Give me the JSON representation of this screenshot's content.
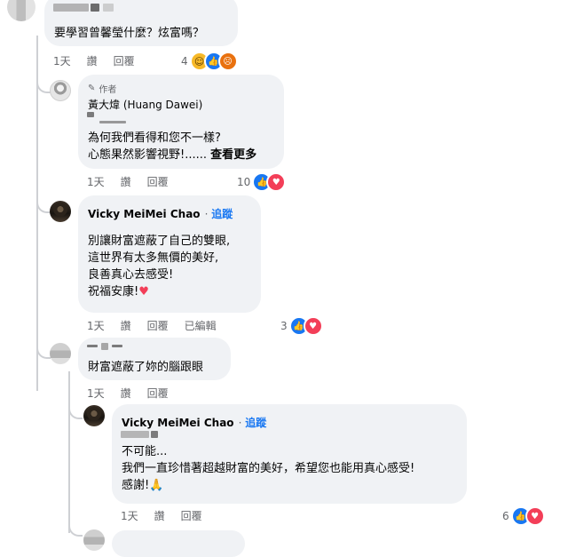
{
  "comments": [
    {
      "id": "c1",
      "text": [
        "要學習曾馨瑩什麼？炫富嗎？"
      ],
      "actions": {
        "time": "1天",
        "like": "讚",
        "reply": "回覆"
      },
      "reaction_count": "4",
      "reaction_icons": [
        "haha-icon",
        "like-icon",
        "angry-icon"
      ]
    },
    {
      "id": "c2",
      "author_badge": "作者",
      "name": "黃大煒 (Huang Dawei)",
      "text": [
        "為何我們看得和您不一樣?",
        "心態果然影響視野!......"
      ],
      "see_more": "查看更多",
      "actions": {
        "time": "1天",
        "like": "讚",
        "reply": "回覆"
      },
      "reaction_count": "10",
      "reaction_icons": [
        "like-icon",
        "love-icon"
      ]
    },
    {
      "id": "c3",
      "name": "Vicky MeiMei Chao",
      "follow": "追蹤",
      "text": [
        "別讓財富遮蔽了自己的雙眼,",
        "這世界有太多無價的美好,",
        "良善真心去感受!",
        "祝福安康!"
      ],
      "text_emoji": "♥",
      "actions": {
        "time": "1天",
        "like": "讚",
        "reply": "回覆",
        "edited": "已編輯"
      },
      "reaction_count": "3",
      "reaction_icons": [
        "like-icon",
        "love-icon"
      ]
    },
    {
      "id": "c4",
      "text": [
        "財富遮蔽了妳的腦跟眼"
      ],
      "actions": {
        "time": "1天",
        "like": "讚",
        "reply": "回覆"
      }
    },
    {
      "id": "c5",
      "name": "Vicky MeiMei Chao",
      "follow": "追蹤",
      "text": [
        "不可能...",
        "我們一直珍惜著超越財富的美好，希望您也能用真心感受!",
        "感謝!"
      ],
      "text_emoji": "🙏",
      "actions": {
        "time": "1天",
        "like": "讚",
        "reply": "回覆"
      },
      "reaction_count": "6",
      "reaction_icons": [
        "like-icon",
        "love-icon"
      ]
    }
  ]
}
